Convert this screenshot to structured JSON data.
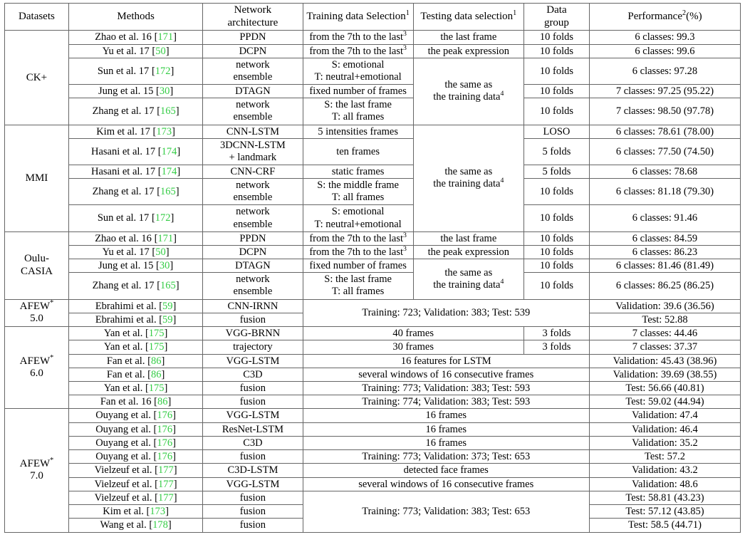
{
  "table": {
    "headers": {
      "datasets": "Datasets",
      "methods": "Methods",
      "network_architecture_l1": "Network",
      "network_architecture_l2": "architecture",
      "training_data_selection": "Training data Selection",
      "training_data_selection_sup": "1",
      "testing_data_selection": "Testing data selection",
      "testing_data_selection_sup": "1",
      "data_group_l1": "Data",
      "data_group_l2": "group",
      "performance": "Performance",
      "performance_sup": "2",
      "performance_unit": "(%)"
    },
    "common": {
      "same_as_training_l1": "the same as",
      "same_as_training_l2": "the training data",
      "same_as_training_sup": "4",
      "from_7th_to_last": "from the 7th to the last",
      "from_7th_to_last_sup": "3",
      "network": "network",
      "ensemble": "ensemble",
      "s_emotional": "S: emotional",
      "t_neutral_emotional": "T: neutral+emotional",
      "s_last_frame": "S: the last frame",
      "s_middle_frame": "S: the middle frame",
      "t_all_frames": "T: all frames",
      "3dcnn_lstm": "3DCNN-LSTM",
      "plus_landmark": "+ landmark"
    },
    "groups": [
      {
        "name": "CK+",
        "label": "CK+",
        "rows": [
          {
            "method": "Zhao et al. 16",
            "ref": "171",
            "arch": "PPDN",
            "train": "from the 7th to the last",
            "train_sup": "3",
            "test": "the last frame",
            "group": "10 folds",
            "perf": "6 classes: 99.3"
          },
          {
            "method": "Yu et al. 17",
            "ref": "50",
            "arch": "DCPN",
            "train": "from the 7th to the last",
            "train_sup": "3",
            "test": "the peak expression",
            "group": "10 folds",
            "perf": "6 classes: 99.6"
          },
          {
            "method": "Sun et al. 17",
            "ref": "172",
            "arch": "network ensemble",
            "train": "S: emotional / T: neutral+emotional",
            "test": "",
            "group": "10 folds",
            "perf": "6 classes: 97.28"
          },
          {
            "method": "Jung et al. 15",
            "ref": "30",
            "arch": "DTAGN",
            "train": "fixed number of frames",
            "test": "",
            "group": "10 folds",
            "perf": "7 classes: 97.25 (95.22)"
          },
          {
            "method": "Zhang et al. 17",
            "ref": "165",
            "arch": "network ensemble",
            "train": "S: the last frame / T: all frames",
            "test": "",
            "group": "10 folds",
            "perf": "7 classes: 98.50 (97.78)"
          }
        ]
      },
      {
        "name": "MMI",
        "label": "MMI",
        "rows": [
          {
            "method": "Kim et al. 17",
            "ref": "173",
            "arch": "CNN-LSTM",
            "train": "5 intensities frames",
            "test": "",
            "group": "LOSO",
            "perf": "6 classes: 78.61 (78.00)"
          },
          {
            "method": "Hasani et al. 17",
            "ref": "174",
            "arch": "3DCNN-LSTM + landmark",
            "train": "ten frames",
            "test": "",
            "group": "5 folds",
            "perf": "6 classes: 77.50 (74.50)"
          },
          {
            "method": "Hasani et al. 17",
            "ref": "174",
            "arch": "CNN-CRF",
            "train": "static frames",
            "test": "",
            "group": "5 folds",
            "perf": "6 classes: 78.68"
          },
          {
            "method": "Zhang et al. 17",
            "ref": "165",
            "arch": "network ensemble",
            "train": "S: the middle frame / T: all frames",
            "test": "",
            "group": "10 folds",
            "perf": "6 classes: 81.18 (79.30)"
          },
          {
            "method": "Sun et al. 17",
            "ref": "172",
            "arch": "network ensemble",
            "train": "S: emotional / T: neutral+emotional",
            "test": "",
            "group": "10 folds",
            "perf": "6 classes: 91.46"
          }
        ]
      },
      {
        "name": "Oulu-CASIA",
        "label_l1": "Oulu-",
        "label_l2": "CASIA",
        "rows": [
          {
            "method": "Zhao et al. 16",
            "ref": "171",
            "arch": "PPDN",
            "train": "from the 7th to the last",
            "train_sup": "3",
            "test": "the last frame",
            "group": "10 folds",
            "perf": "6 classes: 84.59"
          },
          {
            "method": "Yu et al. 17",
            "ref": "50",
            "arch": "DCPN",
            "train": "from the 7th to the last",
            "train_sup": "3",
            "test": "the peak expression",
            "group": "10 folds",
            "perf": "6 classes: 86.23"
          },
          {
            "method": "Jung et al. 15",
            "ref": "30",
            "arch": "DTAGN",
            "train": "fixed number of frames",
            "test": "",
            "group": "10 folds",
            "perf": "6 classes: 81.46 (81.49)"
          },
          {
            "method": "Zhang et al. 17",
            "ref": "165",
            "arch": "network ensemble",
            "train": "S: the last frame / T: all frames",
            "test": "",
            "group": "10 folds",
            "perf": "6 classes: 86.25 (86.25)"
          }
        ]
      },
      {
        "name": "AFEW 5.0",
        "label_l1": "AFEW",
        "label_sup": "*",
        "label_l2": "5.0",
        "merged_selection": "Training: 723; Validation: 383; Test: 539",
        "rows": [
          {
            "method": "Ebrahimi et al.",
            "ref": "59",
            "arch": "CNN-IRNN",
            "perf": "Validation: 39.6 (36.56)"
          },
          {
            "method": "Ebrahimi et al.",
            "ref": "59",
            "arch": "fusion",
            "perf": "Test: 52.88"
          }
        ]
      },
      {
        "name": "AFEW 6.0",
        "label_l1": "AFEW",
        "label_sup": "*",
        "label_l2": "6.0",
        "rows": [
          {
            "method": "Yan et al.",
            "ref": "175",
            "arch": "VGG-BRNN",
            "sel": "40 frames",
            "group": "3 folds",
            "perf": "7 classes: 44.46"
          },
          {
            "method": "Yan et al.",
            "ref": "175",
            "arch": "trajectory",
            "sel": "30 frames",
            "group": "3 folds",
            "perf": "7 classes: 37.37"
          },
          {
            "method": "Fan et al.",
            "ref": "86",
            "arch": "VGG-LSTM",
            "sel": "16 features for LSTM",
            "perf": "Validation: 45.43 (38.96)"
          },
          {
            "method": "Fan et al.",
            "ref": "86",
            "arch": "C3D",
            "sel": "several windows of 16 consecutive frames",
            "perf": "Validation: 39.69 (38.55)"
          },
          {
            "method": "Yan et al.",
            "ref": "175",
            "arch": "fusion",
            "sel": "Training: 773; Validation: 383; Test: 593",
            "perf": "Test: 56.66 (40.81)"
          },
          {
            "method": "Fan et al. 16",
            "ref": "86",
            "arch": "fusion",
            "sel": "Training: 774; Validation: 383; Test: 593",
            "perf": "Test: 59.02 (44.94)"
          }
        ]
      },
      {
        "name": "AFEW 7.0",
        "label_l1": "AFEW",
        "label_sup": "*",
        "label_l2": "7.0",
        "merged_selection_bottom": "Training: 773; Validation: 383; Test: 653",
        "rows": [
          {
            "method": "Ouyang et al.",
            "ref": "176",
            "arch": "VGG-LSTM",
            "sel": "16 frames",
            "perf": "Validation: 47.4"
          },
          {
            "method": "Ouyang et al.",
            "ref": "176",
            "arch": "ResNet-LSTM",
            "sel": "16 frames",
            "perf": "Validation: 46.4"
          },
          {
            "method": "Ouyang et al.",
            "ref": "176",
            "arch": "C3D",
            "sel": "16 frames",
            "perf": "Validation: 35.2"
          },
          {
            "method": "Ouyang et al.",
            "ref": "176",
            "arch": "fusion",
            "sel": "Training: 773; Validation: 373; Test: 653",
            "perf": "Test: 57.2"
          },
          {
            "method": "Vielzeuf et al.",
            "ref": "177",
            "arch": "C3D-LSTM",
            "sel": "detected face frames",
            "perf": "Validation: 43.2"
          },
          {
            "method": "Vielzeuf et al.",
            "ref": "177",
            "arch": "VGG-LSTM",
            "sel": "several windows of 16 consecutive frames",
            "perf": "Validation: 48.6"
          },
          {
            "method": "Vielzeuf et al.",
            "ref": "177",
            "arch": "fusion",
            "sel": "",
            "perf": "Test: 58.81 (43.23)"
          },
          {
            "method": "Kim et al.",
            "ref": "173",
            "arch": "fusion",
            "sel": "",
            "perf": "Test: 57.12 (43.85)"
          },
          {
            "method": "Wang et al.",
            "ref": "178",
            "arch": "fusion",
            "sel": "",
            "perf": "Test: 58.5 (44.71)"
          }
        ]
      }
    ]
  },
  "colors": {
    "reference_green": "#33cc44",
    "rule": "#3a3a3a",
    "cell_border": "#666666",
    "text": "#000000"
  }
}
